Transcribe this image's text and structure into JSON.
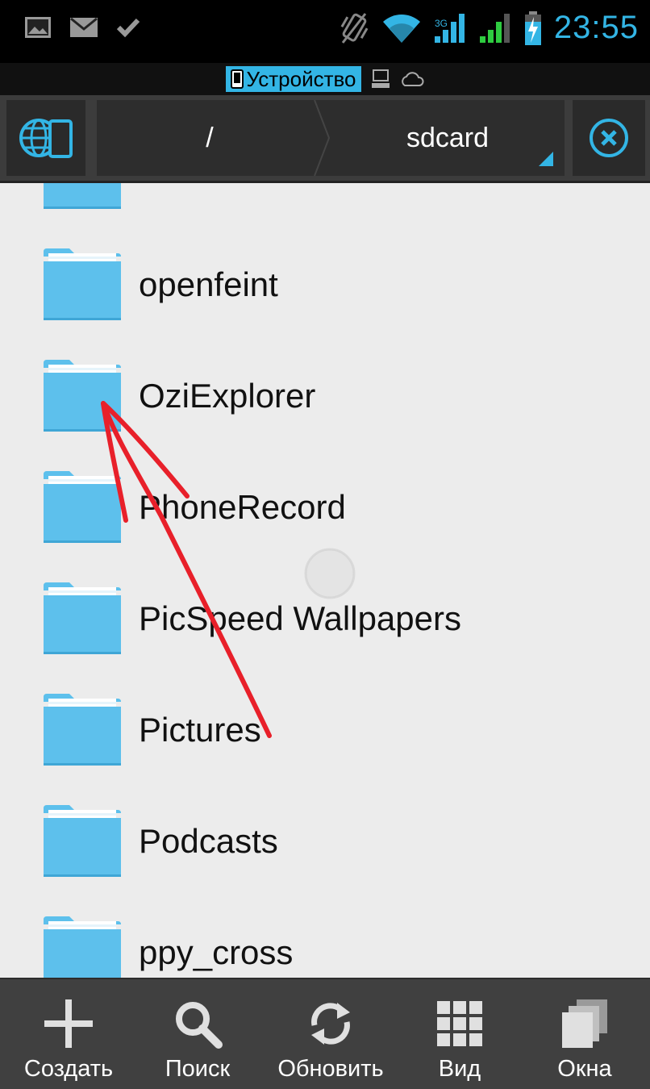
{
  "status_bar": {
    "time": "23:55",
    "icons": [
      "gallery-icon",
      "mail-icon",
      "check-icon",
      "vibrate-icon",
      "wifi-icon",
      "signal-icon",
      "signal-icon",
      "battery-charging-icon"
    ]
  },
  "location_strip": {
    "active_label": "Устройство",
    "other_icons": [
      "computer-icon",
      "cloud-icon"
    ]
  },
  "toolbar": {
    "path": [
      "/",
      "sdcard"
    ],
    "left_icon": "globe-device-icon",
    "right_icon": "close-circle-icon"
  },
  "folders": [
    {
      "name": ""
    },
    {
      "name": "openfeint"
    },
    {
      "name": "OziExplorer"
    },
    {
      "name": "PhoneRecord"
    },
    {
      "name": "PicSpeed Wallpapers"
    },
    {
      "name": "Pictures"
    },
    {
      "name": "Podcasts"
    },
    {
      "name": "ppy_cross"
    }
  ],
  "bottom_bar": {
    "items": [
      {
        "label": "Создать",
        "icon": "plus-icon"
      },
      {
        "label": "Поиск",
        "icon": "search-icon"
      },
      {
        "label": "Обновить",
        "icon": "refresh-icon"
      },
      {
        "label": "Вид",
        "icon": "grid-icon"
      },
      {
        "label": "Окна",
        "icon": "windows-icon"
      }
    ]
  },
  "colors": {
    "accent": "#33b5e5",
    "folder": "#5dc0ec",
    "annotation": "#e8202a"
  }
}
